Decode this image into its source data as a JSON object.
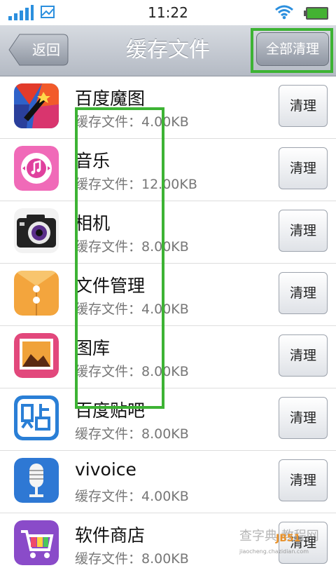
{
  "status_bar": {
    "time": "11:22",
    "signal_icon": "signal-bars-icon",
    "image_icon": "image-icon",
    "wifi_icon": "wifi-icon",
    "battery_icon": "battery-icon"
  },
  "header": {
    "back_label": "返回",
    "title": "缓存文件",
    "clear_all_label": "全部清理"
  },
  "apps": [
    {
      "name": "百度魔图",
      "size": "缓存文件：4.00KB",
      "button": "清理",
      "icon": "baidu-motu-icon"
    },
    {
      "name": " 音乐",
      "size": "缓存文件：12.00KB",
      "button": "清理",
      "icon": "music-icon"
    },
    {
      "name": "相机",
      "size": "缓存文件：8.00KB",
      "button": "清理",
      "icon": "camera-icon"
    },
    {
      "name": "文件管理",
      "size": "缓存文件：4.00KB",
      "button": "清理",
      "icon": "file-manager-icon"
    },
    {
      "name": "图库",
      "size": "缓存文件：8.00KB",
      "button": "清理",
      "icon": "gallery-icon"
    },
    {
      "name": "百度贴吧",
      "size": "缓存文件：8.00KB",
      "button": "清理",
      "icon": "baidu-tieba-icon"
    },
    {
      "name": "vivoice",
      "size": "缓存文件：4.00KB",
      "button": "清理",
      "icon": "microphone-icon"
    },
    {
      "name": "软件商店",
      "size": "缓存文件：8.00KB",
      "button": "清理",
      "icon": "app-store-icon"
    }
  ],
  "watermark": {
    "text": "查字典 教程网",
    "logo": "JB51",
    "url": "jiaocheng.chazidian.com"
  },
  "colors": {
    "highlight": "#3db334",
    "header": "#b4bac4",
    "accent_blue": "#2b8fde"
  }
}
